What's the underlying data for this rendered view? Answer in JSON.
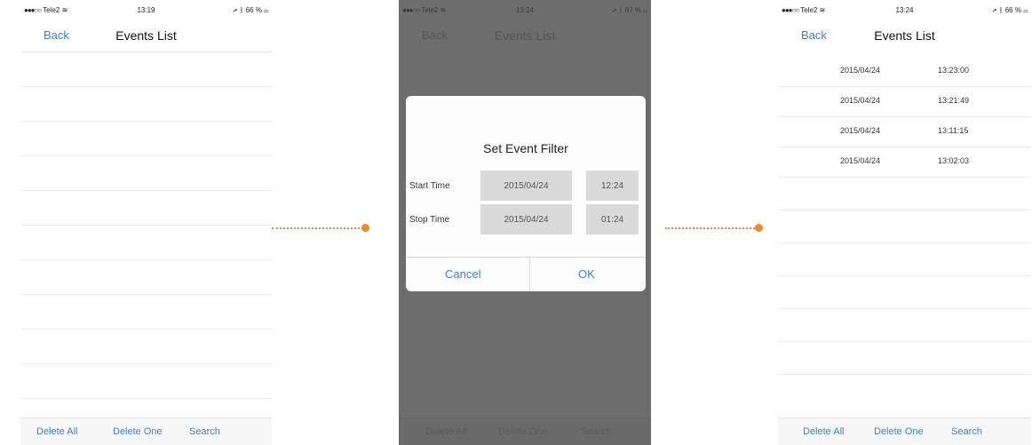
{
  "screens": [
    {
      "status": {
        "carrier": "Tele2",
        "time": "13:19",
        "battery": "66 %"
      },
      "nav": {
        "back": "Back",
        "title": "Events List"
      },
      "toolbar": {
        "delete_all": "Delete All",
        "delete_one": "Delete One",
        "search": "Search"
      }
    },
    {
      "status": {
        "carrier": "Tele2",
        "time": "13:24",
        "battery": "67 %"
      },
      "nav": {
        "back": "Back",
        "title": "Events List"
      },
      "dialog": {
        "title": "Set Event Filter",
        "start_label": "Start Time",
        "start_date": "2015/04/24",
        "start_time": "12:24",
        "stop_label": "Stop Time",
        "stop_date": "2015/04/24",
        "stop_time": "01:24",
        "cancel": "Cancel",
        "ok": "OK"
      },
      "toolbar": {
        "delete_all": "Delete All",
        "delete_one": "Delete One",
        "search": "Search"
      }
    },
    {
      "status": {
        "carrier": "Tele2",
        "time": "13:24",
        "battery": "66 %"
      },
      "nav": {
        "back": "Back",
        "title": "Events List"
      },
      "events": [
        {
          "date": "2015/04/24",
          "time": "13:23:00"
        },
        {
          "date": "2015/04/24",
          "time": "13:21:49"
        },
        {
          "date": "2015/04/24",
          "time": "13:11:15"
        },
        {
          "date": "2015/04/24",
          "time": "13:02:03"
        }
      ],
      "toolbar": {
        "delete_all": "Delete All",
        "delete_one": "Delete One",
        "search": "Search"
      }
    }
  ],
  "colors": {
    "accent": "#3b7fd8",
    "connector": "#f0892a",
    "overlay": "#6d6d6d"
  },
  "icons": [
    "signal-dots-icon",
    "wifi-icon",
    "location-arrow-icon",
    "bluetooth-icon",
    "battery-icon"
  ]
}
